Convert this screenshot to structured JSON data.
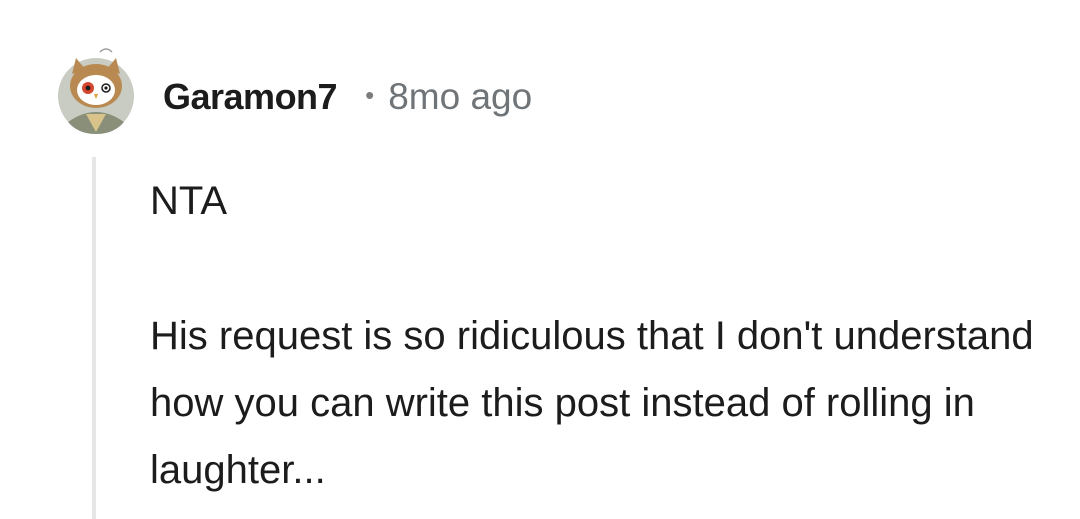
{
  "comment": {
    "username": "Garamon7",
    "separator": "•",
    "timestamp": "8mo ago",
    "paragraphs": [
      "NTA",
      "His request is so ridiculous that I don't understand how you can write this post instead of rolling in laughter..."
    ]
  },
  "avatar": {
    "icon": "owl-avatar-icon"
  }
}
